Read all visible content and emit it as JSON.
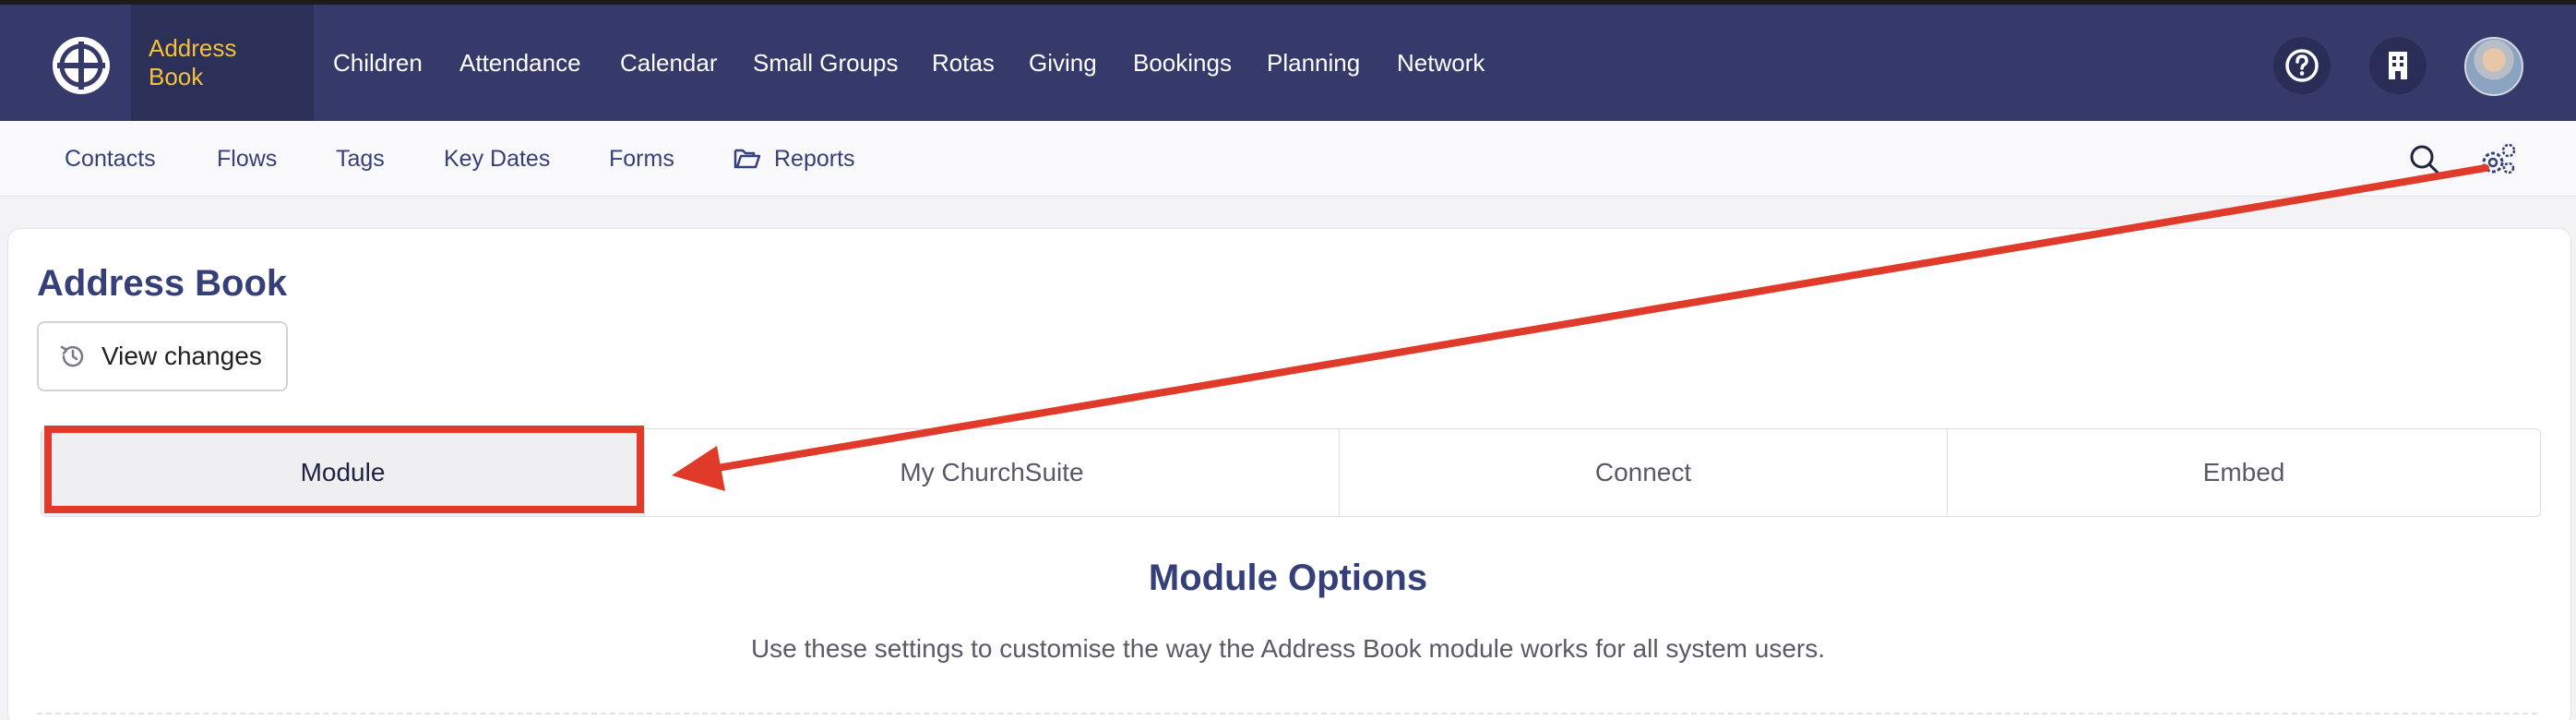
{
  "topnav": {
    "items": [
      {
        "label": "Address Book",
        "active": true
      },
      {
        "label": "Children"
      },
      {
        "label": "Attendance"
      },
      {
        "label": "Calendar"
      },
      {
        "label": "Small Groups"
      },
      {
        "label": "Rotas"
      },
      {
        "label": "Giving"
      },
      {
        "label": "Bookings"
      },
      {
        "label": "Planning"
      },
      {
        "label": "Network"
      }
    ],
    "help_icon": "question-circle-icon",
    "building_icon": "building-icon",
    "avatar": "user-avatar"
  },
  "subnav": {
    "items": [
      {
        "label": "Contacts"
      },
      {
        "label": "Flows"
      },
      {
        "label": "Tags"
      },
      {
        "label": "Key Dates"
      },
      {
        "label": "Forms"
      },
      {
        "label": "Reports",
        "icon": "folder-open-icon"
      }
    ],
    "search_icon": "search-icon",
    "settings_icon": "gears-icon"
  },
  "page": {
    "title": "Address Book",
    "view_changes_label": "View changes"
  },
  "tabs": [
    {
      "label": "Module",
      "selected": true
    },
    {
      "label": "My ChurchSuite"
    },
    {
      "label": "Connect"
    },
    {
      "label": "Embed"
    }
  ],
  "section": {
    "title": "Module Options",
    "description": "Use these settings to customise the way the Address Book module works for all system users."
  },
  "colors": {
    "nav_bg": "#363a6b",
    "active_text": "#f3c23c",
    "accent": "#35407a",
    "annotation": "#e03a2a"
  }
}
